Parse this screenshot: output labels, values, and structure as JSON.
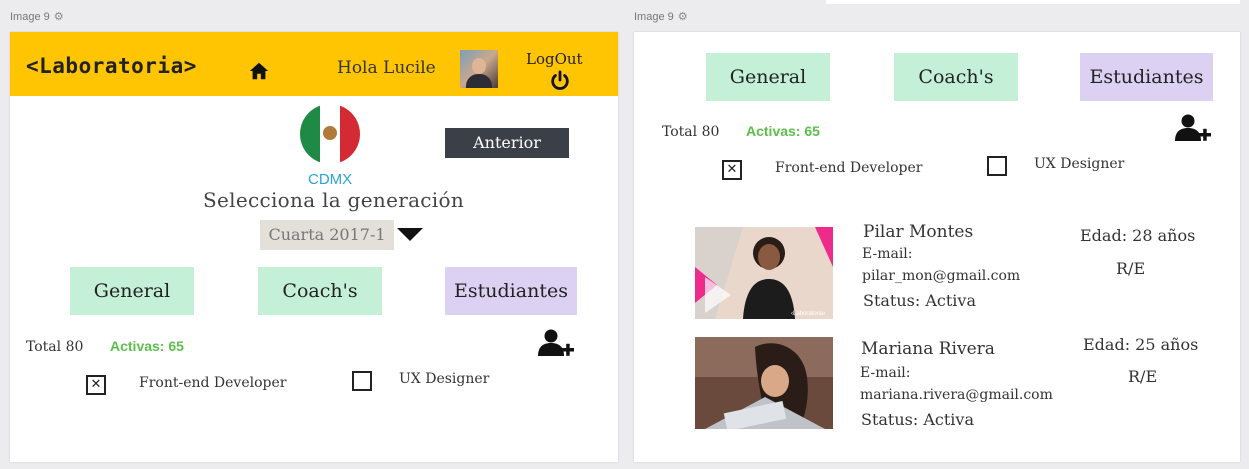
{
  "frames": {
    "left_label": "Image 9",
    "right_label": "Image 9",
    "gear_icon": "gear-icon"
  },
  "header": {
    "logo": "<Laboratoria>",
    "greeting": "Hola Lucile",
    "logout": "LogOut"
  },
  "location": {
    "city": "CDMX",
    "previous_button": "Anterior",
    "generation_title": "Selecciona la generación",
    "generation_selected": "Cuarta 2017-1"
  },
  "tabs": [
    {
      "label": "General"
    },
    {
      "label": "Coach's"
    },
    {
      "label": "Estudiantes"
    }
  ],
  "stats": {
    "total": "Total 80",
    "active": "Activas: 65"
  },
  "filters": [
    {
      "label": "Front-end Developer",
      "checked": true,
      "mark": "✕"
    },
    {
      "label": "UX Designer",
      "checked": false,
      "mark": ""
    }
  ],
  "students": [
    {
      "name": "Pilar Montes",
      "email_label": "E-mail:",
      "email": "pilar_mon@gmail.com",
      "status": "Status: Activa",
      "age": "Edad: 28 años",
      "re": "R/E",
      "photo_caption": "‹Laboratoria›"
    },
    {
      "name": "Mariana Rivera",
      "email_label": "E-mail:",
      "email": "mariana.rivera@gmail.com",
      "status": "Status: Activa",
      "age": "Edad: 25 años",
      "re": "R/E"
    }
  ],
  "colors": {
    "header_bg": "#ffc402",
    "tab_green": "#c4f0d8",
    "tab_purple": "#ddd1f3",
    "active_green": "#5cc04a",
    "city_blue": "#29a3d8",
    "button_dark": "#3a3f48"
  }
}
